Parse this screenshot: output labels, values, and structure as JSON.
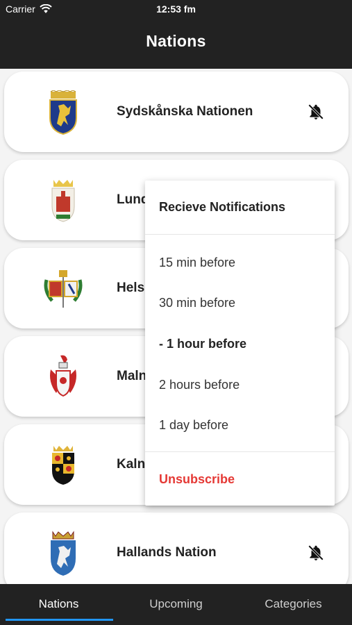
{
  "status_bar": {
    "carrier": "Carrier",
    "time": "12:53 fm"
  },
  "app_bar": {
    "title": "Nations"
  },
  "nations": [
    {
      "name": "Sydskånska Nationen",
      "crest": "crest-gold-griffin-blue-shield",
      "bell": "notifications-off-icon"
    },
    {
      "name": "Lund",
      "crest": "crest-red-castle-white-shield"
    },
    {
      "name": "Hels",
      "crest": "crest-ornate-wreath"
    },
    {
      "name": "Maln",
      "crest": "crest-red-white-mantled"
    },
    {
      "name": "Kaln",
      "crest": "crest-quartered-gold-black"
    },
    {
      "name": "Hallands Nation",
      "crest": "crest-blue-lion-crowned",
      "bell": "notifications-off-icon"
    }
  ],
  "notification_menu": {
    "title": "Recieve Notifications",
    "options": [
      "15 min before",
      "30 min before",
      "- 1 hour before",
      "2 hours before",
      "1 day before"
    ],
    "selected_index": 2,
    "unsubscribe_label": "Unsubscribe",
    "unsubscribe_color": "#e53935"
  },
  "tabs": [
    {
      "label": "Nations",
      "active": true
    },
    {
      "label": "Upcoming",
      "active": false
    },
    {
      "label": "Categories",
      "active": false
    }
  ],
  "colors": {
    "bar_background": "#222222",
    "tab_indicator": "#2196f3"
  }
}
